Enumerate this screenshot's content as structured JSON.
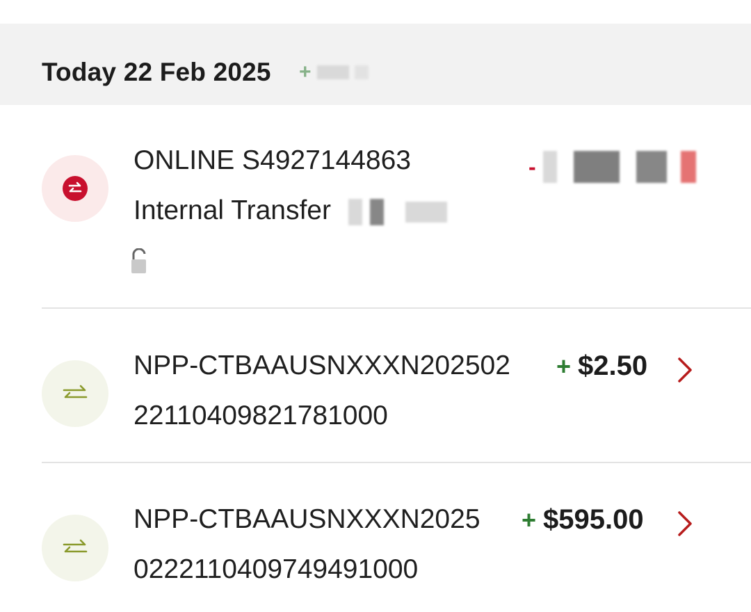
{
  "header": {
    "date_label": "Today 22 Feb 2025",
    "total_sign": "+"
  },
  "transactions": [
    {
      "line1": "ONLINE S4927144863",
      "line2": "Internal Transfer",
      "amount_sign": "-",
      "icon": "transfer-arrows-icon",
      "status_icon": "unlock-icon",
      "type": "debit"
    },
    {
      "line1": "NPP-CTBAAUSNXXXN202502",
      "line2": "22110409821781000",
      "amount_sign": "+",
      "amount": "$2.50",
      "icon": "transfer-arrows-icon",
      "type": "credit"
    },
    {
      "line1": "NPP-CTBAAUSNXXXN2025",
      "line2": "0222110409749491000",
      "amount_sign": "+",
      "amount": "$595.00",
      "icon": "transfer-arrows-icon",
      "type": "credit"
    }
  ],
  "colors": {
    "debit_accent": "#c8102e",
    "credit_accent": "#2e7d32",
    "chevron": "#b71c1c",
    "header_bg": "#f2f2f2"
  }
}
